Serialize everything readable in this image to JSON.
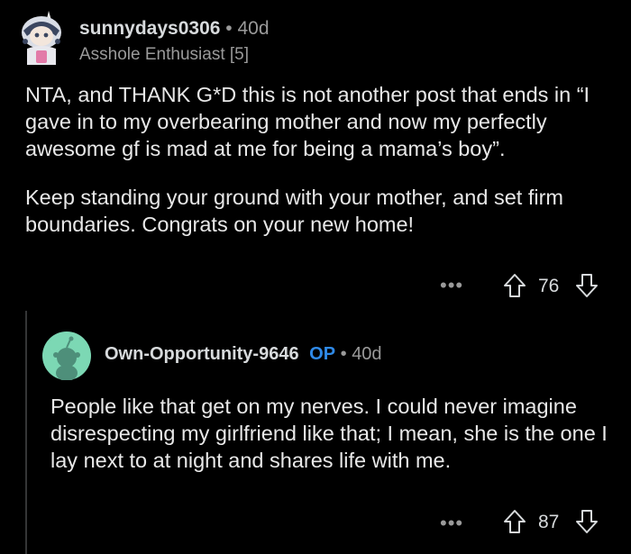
{
  "parent_comment": {
    "username": "sunnydays0306",
    "separator": "•",
    "age": "40d",
    "flair": "Asshole Enthusiast [5]",
    "paragraphs": [
      "NTA, and THANK G*D this is not another post that ends in “I gave in to my overbearing mother and now my perfectly awesome gf is mad at me for being a mama’s boy”.",
      "Keep standing your ground with your mother, and set firm boundaries. Congrats on your new home!"
    ],
    "more_label": "•••",
    "score": "76",
    "upvote_icon": "upvote-arrow-icon",
    "downvote_icon": "downvote-arrow-icon"
  },
  "reply": {
    "username": "Own-Opportunity-9646",
    "op_badge": "OP",
    "separator": "•",
    "age": "40d",
    "paragraphs": [
      "People like that get on my nerves. I could never imagine disrespecting my girlfriend like that; I mean, she is the one I lay next to at night and shares life with me."
    ],
    "more_label": "•••",
    "score": "87",
    "upvote_icon": "upvote-arrow-icon",
    "downvote_icon": "downvote-arrow-icon"
  },
  "colors": {
    "background": "#000000",
    "text": "#e8e8e8",
    "muted": "#9a9a9a",
    "op_blue": "#2f8ae8",
    "thread_line": "#343536",
    "default_avatar_bg": "#7cd8b4"
  }
}
